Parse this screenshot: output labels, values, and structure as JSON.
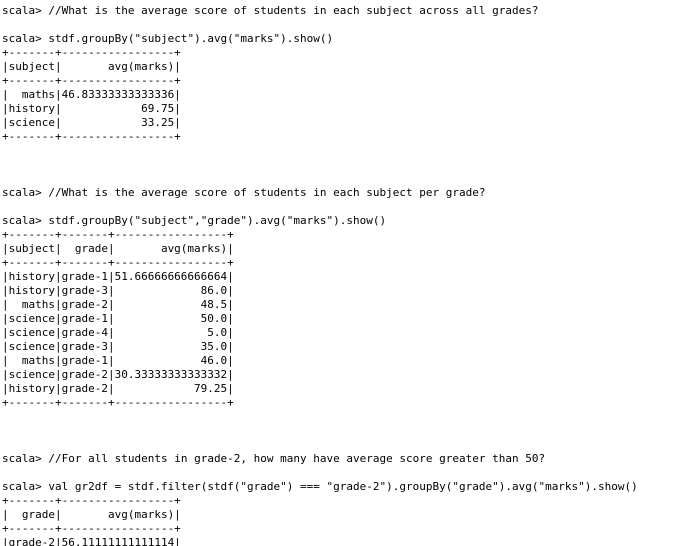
{
  "prompt": "scala>",
  "blocks": [
    {
      "comment": "//What is the average score of students in each subject across all grades?",
      "command": "stdf.groupBy(\"subject\").avg(\"marks\").show()",
      "table": [
        "+-------+-----------------+",
        "|subject|       avg(marks)|",
        "+-------+-----------------+",
        "|  maths|46.83333333333336|",
        "|history|            69.75|",
        "|science|            33.25|",
        "+-------+-----------------+"
      ]
    },
    {
      "comment": "//What is the average score of students in each subject per grade?",
      "command": "stdf.groupBy(\"subject\",\"grade\").avg(\"marks\").show()",
      "table": [
        "+-------+-------+-----------------+",
        "|subject|  grade|       avg(marks)|",
        "+-------+-------+-----------------+",
        "|history|grade-1|51.66666666666664|",
        "|history|grade-3|             86.0|",
        "|  maths|grade-2|             48.5|",
        "|science|grade-1|             50.0|",
        "|science|grade-4|              5.0|",
        "|science|grade-3|             35.0|",
        "|  maths|grade-1|             46.0|",
        "|science|grade-2|30.33333333333332|",
        "|history|grade-2|            79.25|",
        "+-------+-------+-----------------+"
      ]
    },
    {
      "comment": "//For all students in grade-2, how many have average score greater than 50?",
      "command": "val gr2df = stdf.filter(stdf(\"grade\") === \"grade-2\").groupBy(\"grade\").avg(\"marks\").show()",
      "table": [
        "+-------+-----------------+",
        "|  grade|       avg(marks)|",
        "+-------+-----------------+",
        "|grade-2|56.11111111111114|",
        "+-------+-----------------+"
      ]
    }
  ]
}
